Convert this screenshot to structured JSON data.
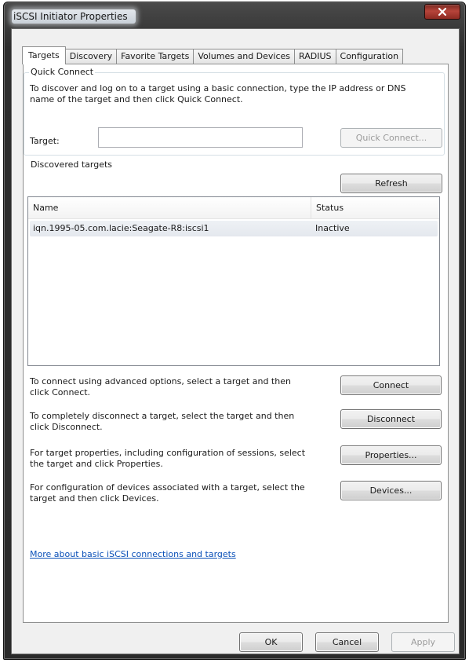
{
  "window": {
    "title": "iSCSI Initiator Properties"
  },
  "tabs": [
    {
      "label": "Targets",
      "active": true
    },
    {
      "label": "Discovery",
      "active": false
    },
    {
      "label": "Favorite Targets",
      "active": false
    },
    {
      "label": "Volumes and Devices",
      "active": false
    },
    {
      "label": "RADIUS",
      "active": false
    },
    {
      "label": "Configuration",
      "active": false
    }
  ],
  "quick_connect": {
    "group_label": "Quick Connect",
    "description": "To discover and log on to a target using a basic connection, type the IP address or DNS name of the target and then click Quick Connect.",
    "target_label": "Target:",
    "target_value": "",
    "button_label": "Quick Connect..."
  },
  "discovered": {
    "group_label": "Discovered targets",
    "refresh_label": "Refresh",
    "columns": [
      "Name",
      "Status"
    ],
    "rows": [
      {
        "name": "iqn.1995-05.com.lacie:Seagate-R8:iscsi1",
        "status": "Inactive"
      }
    ]
  },
  "actions": [
    {
      "description": "To connect using advanced options, select a target and then click Connect.",
      "button": "Connect"
    },
    {
      "description": "To completely disconnect a target, select the target and then click Disconnect.",
      "button": "Disconnect"
    },
    {
      "description": "For target properties, including configuration of sessions, select the target and click Properties.",
      "button": "Properties..."
    },
    {
      "description": "For configuration of devices associated with a target, select the target and then click Devices.",
      "button": "Devices..."
    }
  ],
  "help_link": "More about basic iSCSI connections and targets",
  "footer": {
    "ok": "OK",
    "cancel": "Cancel",
    "apply": "Apply"
  }
}
